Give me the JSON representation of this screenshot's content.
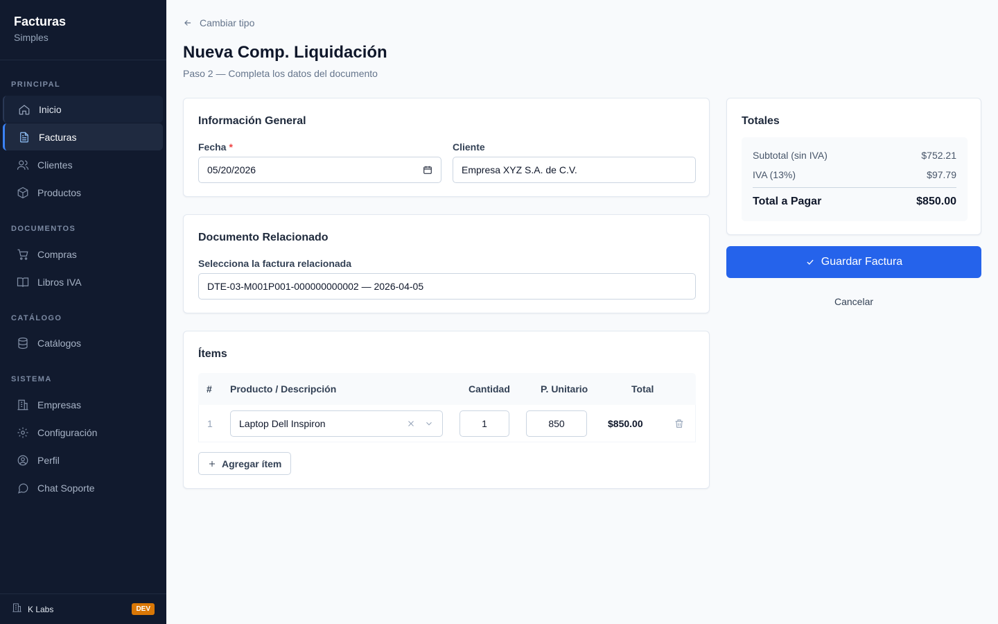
{
  "sidebar": {
    "brand_title": "Facturas",
    "brand_sub": "Simples",
    "sections": {
      "principal": "PRINCIPAL",
      "documentos": "DOCUMENTOS",
      "catalogo": "CATÁLOGO",
      "sistema": "SISTEMA"
    },
    "items": {
      "inicio": "Inicio",
      "facturas": "Facturas",
      "clientes": "Clientes",
      "productos": "Productos",
      "compras": "Compras",
      "libros_iva": "Libros IVA",
      "catalogos": "Catálogos",
      "empresas": "Empresas",
      "configuracion": "Configuración",
      "perfil": "Perfil",
      "chat_soporte": "Chat Soporte"
    },
    "active_item": "Facturas",
    "footer": {
      "org": "K Labs",
      "badge": "DEV",
      "badge_color": "#d97706"
    }
  },
  "header": {
    "back_label": "Cambiar tipo",
    "title": "Nueva Comp. Liquidación",
    "subtitle": "Paso 2 — Completa los datos del documento"
  },
  "general": {
    "title": "Información General",
    "fecha_label": "Fecha",
    "required_mark": "*",
    "fecha_value": "05/20/2026",
    "cliente_label": "Cliente",
    "cliente_value": "Empresa XYZ S.A. de C.V."
  },
  "related": {
    "title": "Documento Relacionado",
    "label": "Selecciona la factura relacionada",
    "value": "DTE-03-M001P001-000000000002 — 2026-04-05"
  },
  "items": {
    "title": "Ítems",
    "columns": {
      "num": "#",
      "product": "Producto / Descripción",
      "qty": "Cantidad",
      "unit_price": "P. Unitario",
      "total": "Total"
    },
    "rows": [
      {
        "num": "1",
        "product": "Laptop Dell Inspiron",
        "qty": "1",
        "unit_price": "850",
        "total": "$850.00"
      }
    ],
    "add_label": "Agregar ítem"
  },
  "totals": {
    "title": "Totales",
    "subtotal_label": "Subtotal (sin IVA)",
    "subtotal_value": "$752.21",
    "iva_label": "IVA (13%)",
    "iva_value": "$97.79",
    "total_label": "Total a Pagar",
    "total_value": "$850.00"
  },
  "actions": {
    "save_label": "Guardar Factura",
    "cancel_label": "Cancelar",
    "accent_color": "#2563eb"
  }
}
